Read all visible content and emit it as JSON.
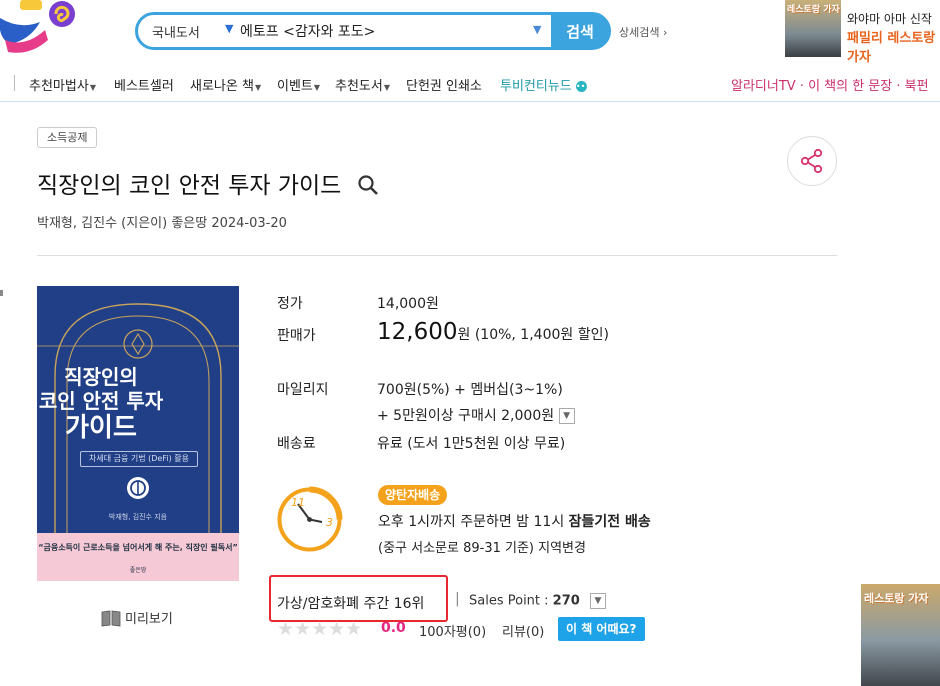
{
  "search": {
    "category": "국내도서",
    "query": "에토프 <감자와 포도>",
    "button_label": "검색",
    "detail_search": "상세검색"
  },
  "ad_top": {
    "line1": "와야마 아마 신작",
    "line2": "패밀리 레스토랑 가자",
    "image_text": "레스토랑 가자"
  },
  "nav": {
    "items": [
      "추천마법사",
      "베스트셀러",
      "새로나온 책",
      "이벤트",
      "추천도서",
      "단헌권 인쇄소",
      "투비컨티뉴드"
    ],
    "right": "알라디너TV · 이 책의 한 문장 · 북펀"
  },
  "book": {
    "badge": "소득공제",
    "title": "직장인의 코인 안전 투자 가이드",
    "authors": "박재형, 김진수 (지은이) 좋은땅 2024-03-20",
    "cover": {
      "title_lines": [
        "직장인의",
        "코인 안전 투자",
        "가이드"
      ],
      "subtitle": "차세대 금융 기법 (DeFi) 활용",
      "authors": "박재형, 김진수 지음",
      "quote": "“금융소득이 근로소득을 넘어서게 해 주는, 직장인 필독서”",
      "publisher": "좋은땅"
    },
    "preview_label": "미리보기"
  },
  "price": {
    "list_label": "정가",
    "list_value": "14,000원",
    "sale_label": "판매가",
    "sale_value": "12,600",
    "sale_unit": "원",
    "sale_discount": "(10%, 1,400원 할인)",
    "mileage_label": "마일리지",
    "mileage_line1": "700원(5%) + 멤버십(3~1%)",
    "mileage_line2": "+ 5만원이상 구매시 2,000원",
    "shipping_label": "배송료",
    "shipping_value": "유료 (도서 1만5천원 이상 무료)"
  },
  "delivery": {
    "badge": "양탄자배송",
    "line1_prefix": "오후 1시까지 주문하면 밤 11시 ",
    "line1_bold": "잠들기전 배송",
    "line2": "(중구 서소문로 89-31 기준) 지역변경",
    "clock_start": "11",
    "clock_end": "3"
  },
  "rank": {
    "text": "가상/암호화폐 주간 16위",
    "sales_point_label": "Sales Point : ",
    "sales_point_value": "270",
    "score": "0.0",
    "rating": 0,
    "review100": "100자평(0)",
    "review": "리뷰(0)",
    "how_button": "이 책 어때요?"
  },
  "ad_side": {
    "image_text": "레스토랑 가자"
  },
  "colors": {
    "accent_blue": "#3ba4de",
    "magenta": "#c9306b",
    "red_box": "#e8272f",
    "orange": "#f4a21b",
    "cover_navy": "#213f86"
  }
}
